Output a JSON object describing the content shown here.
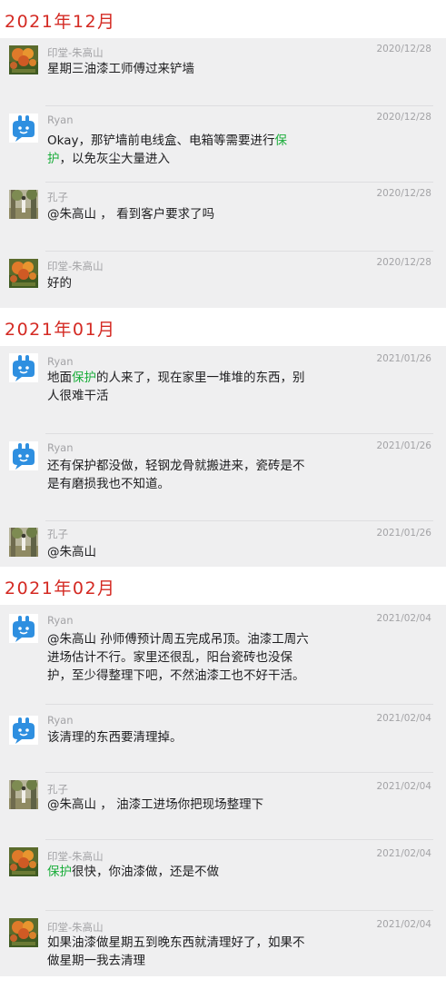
{
  "groups": [
    {
      "month": "2021年12月",
      "messages": [
        {
          "sender": "印堂-朱高山",
          "avatar": "flower-avatar",
          "date": "2020/12/28",
          "text": [
            "星期三油漆工师傅过来铲墙"
          ]
        },
        {
          "sender": "Ryan",
          "avatar": "bunny-avatar",
          "date": "2020/12/28",
          "text": [
            "Okay，那铲墙前电线盒、电箱等需要进行",
            "保",
            "护",
            "，以免灰尘大量进入"
          ]
        },
        {
          "sender": "孔子",
          "avatar": "outdoor-avatar",
          "date": "2020/12/28",
          "text": [
            "@朱高山 ， 看到客户要求了吗"
          ]
        },
        {
          "sender": "印堂-朱高山",
          "avatar": "flower-avatar",
          "date": "2020/12/28",
          "text": [
            "好的"
          ]
        }
      ]
    },
    {
      "month": "2021年01月",
      "messages": [
        {
          "sender": "Ryan",
          "avatar": "bunny-avatar",
          "date": "2021/01/26",
          "text": [
            "地面",
            "保护",
            "的人来了，现在家里一堆堆的东西，别",
            "人很难干活"
          ]
        },
        {
          "sender": "Ryan",
          "avatar": "bunny-avatar",
          "date": "2021/01/26",
          "text": [
            "还有保护都没做，轻钢龙骨就搬进来，瓷砖是不",
            "是有磨损我也不知道。"
          ]
        },
        {
          "sender": "孔子",
          "avatar": "outdoor-avatar",
          "date": "2021/01/26",
          "text": [
            "@朱高山"
          ]
        }
      ]
    },
    {
      "month": "2021年02月",
      "messages": [
        {
          "sender": "Ryan",
          "avatar": "bunny-avatar",
          "date": "2021/02/04",
          "text": [
            "@朱高山 孙师傅预计周五完成吊顶。油漆工周六",
            "进场估计不行。家里还很乱，阳台瓷砖也没保",
            "护，至少得整理下吧，不然油漆工也不好干活。"
          ]
        },
        {
          "sender": "Ryan",
          "avatar": "bunny-avatar",
          "date": "2021/02/04",
          "text": [
            "该清理的东西要清理掉。"
          ]
        },
        {
          "sender": "孔子",
          "avatar": "outdoor-avatar",
          "date": "2021/02/04",
          "text": [
            "@朱高山 ， 油漆工进场你把现场整理下"
          ]
        },
        {
          "sender": "印堂-朱高山",
          "avatar": "flower-avatar",
          "date": "2021/02/04",
          "text": [
            "保护",
            "很快，你油漆做，还是不做"
          ]
        },
        {
          "sender": "印堂-朱高山",
          "avatar": "flower-avatar",
          "date": "2021/02/04",
          "text": [
            "如果油漆做星期五到晚东西就清理好了，如果不",
            "做星期一我去清理"
          ]
        }
      ]
    }
  ],
  "colors": {
    "month": "#d42a23",
    "highlight": "#1aad3a",
    "meta": "#a3a3a6",
    "group_bg": "#efeff0"
  }
}
